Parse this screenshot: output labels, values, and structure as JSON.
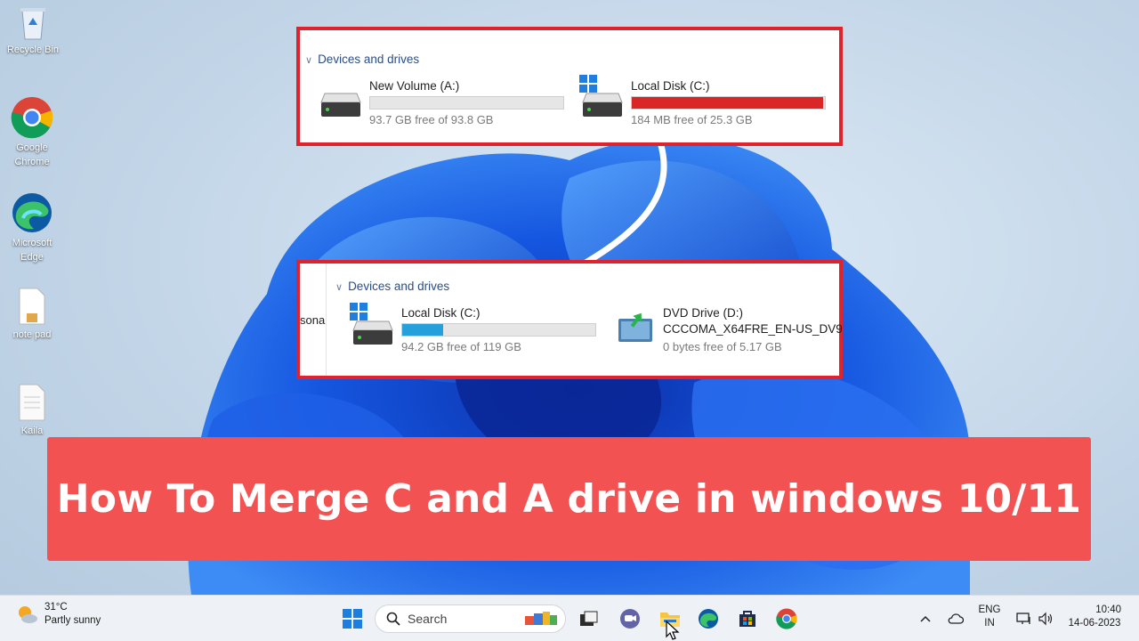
{
  "desktop": {
    "icons": [
      {
        "label": "Recycle Bin"
      },
      {
        "label": "Google Chrome"
      },
      {
        "label": "Microsoft Edge"
      },
      {
        "label": "note pad"
      },
      {
        "label": "Kaila"
      }
    ]
  },
  "panel_before": {
    "section": "Devices and drives",
    "drives": [
      {
        "name": "New Volume (A:)",
        "free": "93.7 GB free of 93.8 GB",
        "used_fraction": 0.0,
        "bar_color": "#26a0da"
      },
      {
        "name": "Local Disk (C:)",
        "free": "184 MB free of 25.3 GB",
        "used_fraction": 0.99,
        "bar_color": "#da2626"
      }
    ]
  },
  "panel_after": {
    "cut_label": "sona",
    "section": "Devices and drives",
    "drives": [
      {
        "name": "Local Disk (C:)",
        "free": "94.2 GB free of 119 GB",
        "used_fraction": 0.21,
        "bar_color": "#26a0da"
      },
      {
        "name": "DVD Drive (D:)",
        "subtitle": "CCCOMA_X64FRE_EN-US_DV9",
        "free": "0 bytes free of 5.17 GB"
      }
    ]
  },
  "banner": {
    "title": "How To Merge C and A drive in windows 10/11",
    "color": "#f35252"
  },
  "taskbar": {
    "weather": {
      "temp": "31°C",
      "desc": "Partly sunny"
    },
    "search_placeholder": "Search",
    "apps": [
      "widgets-icon",
      "task-view-icon",
      "teams-chat-icon",
      "file-explorer-icon",
      "edge-icon",
      "store-icon",
      "chrome-icon"
    ],
    "language": {
      "line1": "ENG",
      "line2": "IN"
    },
    "clock": {
      "time": "10:40",
      "date": "14-06-2023"
    }
  }
}
